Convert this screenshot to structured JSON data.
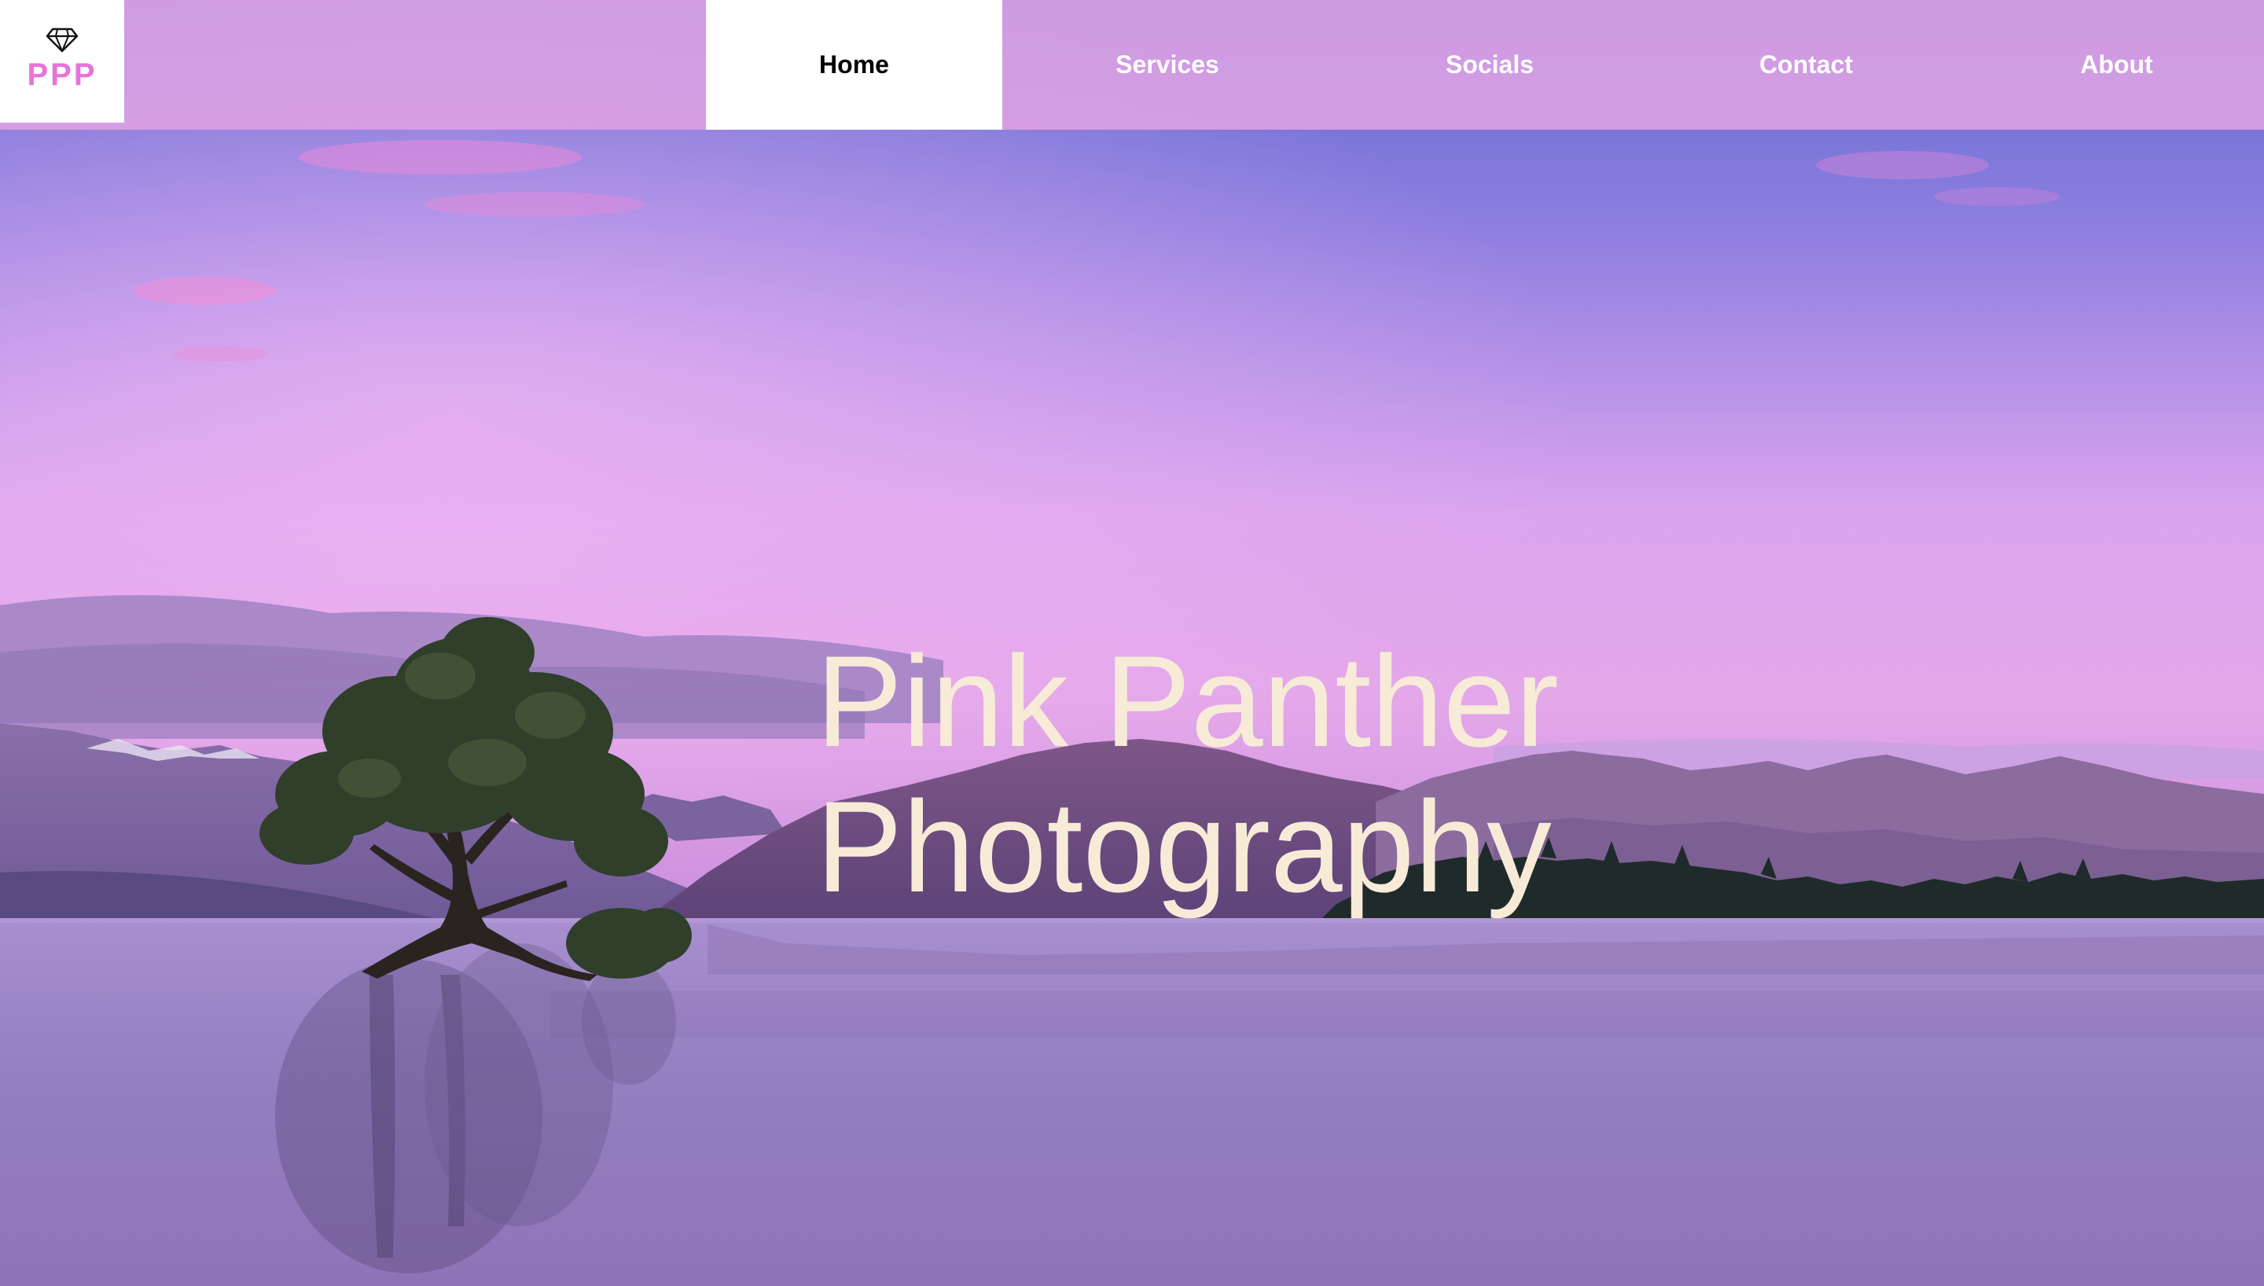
{
  "logo": {
    "text": "PPP",
    "icon": "diamond-icon",
    "color": "#e873d9"
  },
  "nav": {
    "items": [
      {
        "label": "Home",
        "active": true
      },
      {
        "label": "Services",
        "active": false
      },
      {
        "label": "Socials",
        "active": false
      },
      {
        "label": "Contact",
        "active": false
      },
      {
        "label": "About",
        "active": false
      }
    ]
  },
  "hero": {
    "title_line1": "Pink Panther",
    "title_line2": "Photography",
    "title_color": "#f7ebd8",
    "background": "lake-tree-mountains-sunset-photo"
  },
  "colors": {
    "nav_bar": "#dea2e4",
    "active_tab": "#ffffff",
    "sky_top": "#6a6fd6",
    "sky_pink": "#e8a8ef",
    "water": "#9a84c6"
  }
}
